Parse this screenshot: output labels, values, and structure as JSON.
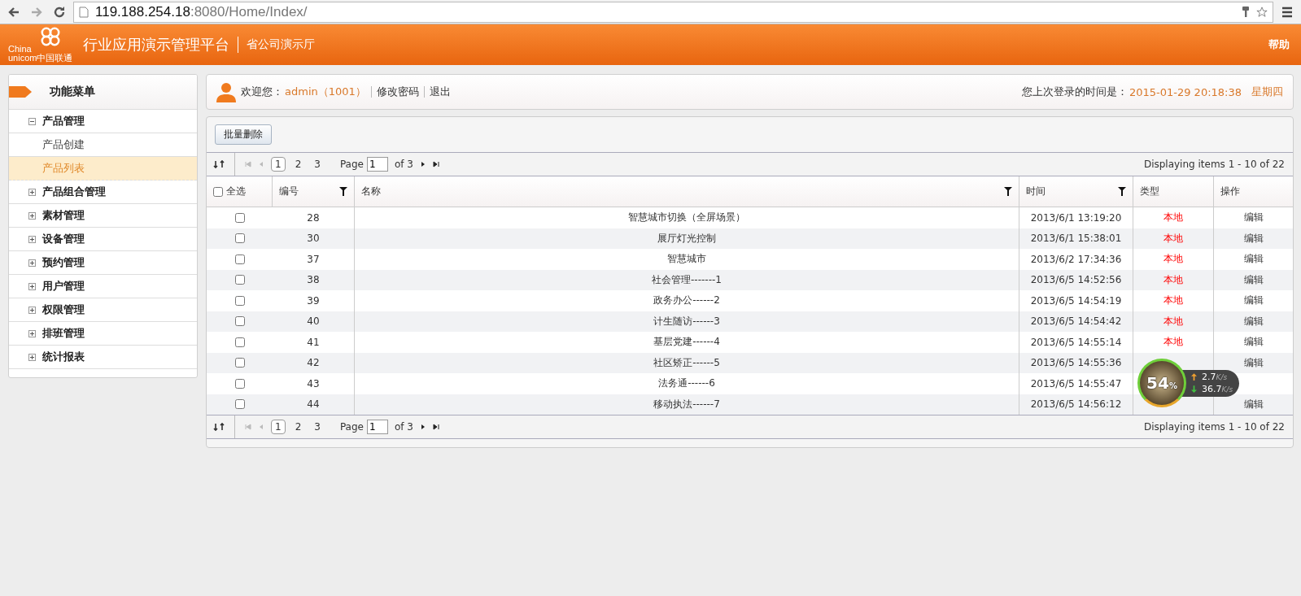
{
  "browser": {
    "url_host": "119.188.254.18",
    "url_path": ":8080/Home/Index/"
  },
  "header": {
    "logo_line1": "China",
    "logo_line2": "unicom中国联通",
    "title": "行业应用演示管理平台",
    "subtitle": "省公司演示厅",
    "help": "帮助"
  },
  "sidebar": {
    "title": "功能菜单",
    "groups": [
      {
        "label": "产品管理",
        "expanded": true,
        "children": [
          {
            "label": "产品创建",
            "selected": false
          },
          {
            "label": "产品列表",
            "selected": true
          }
        ]
      },
      {
        "label": "产品组合管理",
        "expanded": false
      },
      {
        "label": "素材管理",
        "expanded": false
      },
      {
        "label": "设备管理",
        "expanded": false
      },
      {
        "label": "预约管理",
        "expanded": false
      },
      {
        "label": "用户管理",
        "expanded": false
      },
      {
        "label": "权限管理",
        "expanded": false
      },
      {
        "label": "排班管理",
        "expanded": false
      },
      {
        "label": "统计报表",
        "expanded": false
      }
    ]
  },
  "user_bar": {
    "welcome": "欢迎您：",
    "user": "admin（1001）",
    "links": [
      "修改密码",
      "退出"
    ],
    "last_login_label": "您上次登录的时间是：",
    "last_login_time": "2015-01-29 20:18:38",
    "weekday": "星期四"
  },
  "toolbar": {
    "button": "批量删除"
  },
  "pagers": [
    {
      "pages": [
        {
          "label": "1",
          "selected": true
        },
        {
          "label": "2",
          "selected": false
        },
        {
          "label": "3",
          "selected": false
        }
      ],
      "page_label": "Page",
      "page_value": "1",
      "of_label": "of 3",
      "summary": "Displaying items 1 - 10 of 22"
    },
    {
      "pages": [
        {
          "label": "1",
          "selected": true
        },
        {
          "label": "2",
          "selected": false
        },
        {
          "label": "3",
          "selected": false
        }
      ],
      "page_label": "Page",
      "page_value": "1",
      "of_label": "of 3",
      "summary": "Displaying items 1 - 10 of 22"
    }
  ],
  "table": {
    "select_all": {
      "label": "全选",
      "checked": false
    },
    "columns": [
      {
        "label": "编号",
        "filter": true
      },
      {
        "label": "名称",
        "filter": true
      },
      {
        "label": "时间",
        "filter": true
      },
      {
        "label": "类型",
        "filter": false
      },
      {
        "label": "操作",
        "filter": false
      }
    ],
    "rows": [
      {
        "checked": false,
        "id": "28",
        "name": "智慧城市切换（全屏场景）",
        "time": "2013/6/1 13:19:20",
        "type": "本地",
        "action": "编辑"
      },
      {
        "checked": false,
        "id": "30",
        "name": "展厅灯光控制",
        "time": "2013/6/1 15:38:01",
        "type": "本地",
        "action": "编辑"
      },
      {
        "checked": false,
        "id": "37",
        "name": "智慧城市",
        "time": "2013/6/2 17:34:36",
        "type": "本地",
        "action": "编辑"
      },
      {
        "checked": false,
        "id": "38",
        "name": "社会管理-------1",
        "time": "2013/6/5 14:52:56",
        "type": "本地",
        "action": "编辑"
      },
      {
        "checked": false,
        "id": "39",
        "name": "政务办公------2",
        "time": "2013/6/5 14:54:19",
        "type": "本地",
        "action": "编辑"
      },
      {
        "checked": false,
        "id": "40",
        "name": "计生随访------3",
        "time": "2013/6/5 14:54:42",
        "type": "本地",
        "action": "编辑"
      },
      {
        "checked": false,
        "id": "41",
        "name": "基层党建------4",
        "time": "2013/6/5 14:55:14",
        "type": "本地",
        "action": "编辑"
      },
      {
        "checked": false,
        "id": "42",
        "name": "社区矫正------5",
        "time": "2013/6/5 14:55:36",
        "action": "编辑"
      },
      {
        "checked": false,
        "id": "43",
        "name": "法务通------6",
        "time": "2013/6/5 14:55:47"
      },
      {
        "checked": false,
        "id": "44",
        "name": "移动执法------7",
        "time": "2013/6/5 14:56:12",
        "action": "编辑"
      }
    ]
  },
  "speed_widget": {
    "percent": "54",
    "percent_unit": "%",
    "up_value": "2.7",
    "up_unit": "K/s",
    "down_value": "36.7",
    "down_unit": "K/s"
  }
}
